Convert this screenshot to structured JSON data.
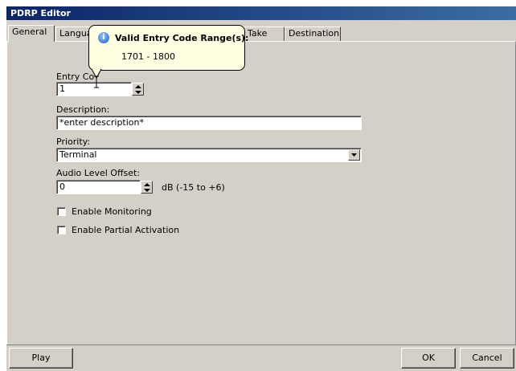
{
  "window": {
    "title": "PDRP Editor"
  },
  "tabs": [
    {
      "label": "General",
      "active": true
    },
    {
      "label": "Languag"
    },
    {
      "label": ""
    },
    {
      "label": "mble Take"
    },
    {
      "label": "Destination"
    }
  ],
  "form": {
    "entry_code": {
      "label": "Entry Co",
      "value": "1"
    },
    "description": {
      "label": "Description:",
      "value": "*enter description*"
    },
    "priority": {
      "label": "Priority:",
      "value": "Terminal"
    },
    "audio_level": {
      "label": "Audio Level Offset:",
      "value": "0",
      "unit": "dB (-15 to +6)"
    },
    "enable_monitoring": {
      "label": "Enable Monitoring",
      "checked": false
    },
    "enable_partial": {
      "label": "Enable Partial Activation",
      "checked": false
    }
  },
  "tooltip": {
    "icon": "info-icon",
    "title": "Valid Entry Code Range(s):",
    "body": "1701 - 1800"
  },
  "footer": {
    "play": "Play",
    "ok": "OK",
    "cancel": "Cancel"
  },
  "colors": {
    "titlebar": "#0a246a",
    "panel": "#d4d0c8",
    "tooltip_bg": "#ffffe1"
  }
}
